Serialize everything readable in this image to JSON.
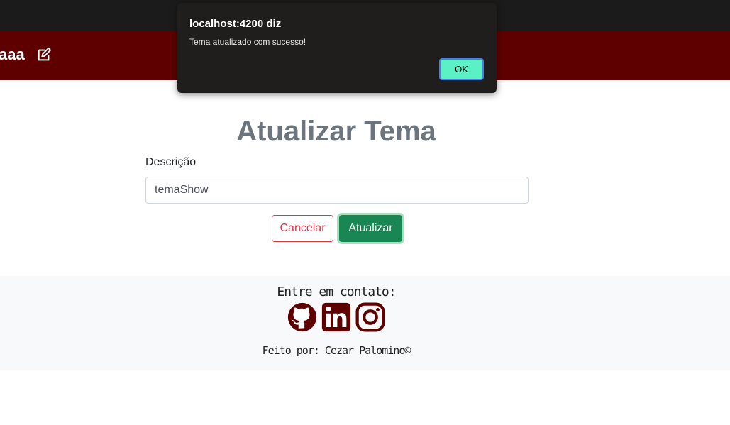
{
  "navbar": {
    "user_name": "aaa",
    "edit_icon": "edit-icon"
  },
  "page": {
    "title": "Atualizar Tema"
  },
  "form": {
    "description_label": "Descrição",
    "description_value": "temaShow",
    "cancel_label": "Cancelar",
    "update_label": "Atualizar"
  },
  "footer": {
    "contact_title": "Entre em contato:",
    "social_icons": [
      "github-icon",
      "linkedin-icon",
      "instagram-icon"
    ],
    "credit": "Feito por: Cezar Palomino©"
  },
  "alert": {
    "title": "localhost:4200 diz",
    "message": "Tema atualizado com sucesso!",
    "ok_label": "OK"
  },
  "colors": {
    "navbar": "#5e0000",
    "social_icon": "#5e0000",
    "cancel": "#dc3545",
    "update": "#198754",
    "ok_button": "#5bf1c4"
  }
}
